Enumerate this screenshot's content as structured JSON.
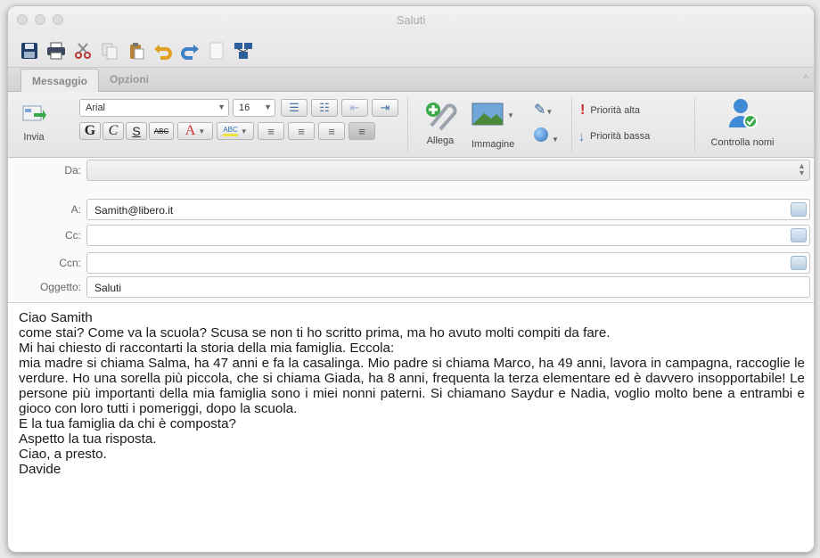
{
  "window": {
    "title": "Saluti"
  },
  "toolbar": {
    "buttons": [
      "save-icon",
      "print-icon",
      "cut-icon",
      "copy-icon",
      "paste-icon",
      "undo-icon",
      "redo-icon",
      "document-icon",
      "network-icon"
    ]
  },
  "tabs": [
    {
      "label": "Messaggio",
      "active": true
    },
    {
      "label": "Opzioni",
      "active": false
    }
  ],
  "ribbon": {
    "send_label": "Invia",
    "font_name": "Arial",
    "font_size": "16",
    "bold": "G",
    "italic": "C",
    "underline": "S",
    "strike": "ABC",
    "font_color": "A",
    "highlight": "ABC",
    "attach_label": "Allega",
    "image_label": "Immagine",
    "priority_high": "Priorità alta",
    "priority_low": "Priorità bassa",
    "check_names": "Controlla nomi"
  },
  "header": {
    "from": {
      "label": "Da:",
      "value": ""
    },
    "to": {
      "label": "A:",
      "value": "Samith@libero.it"
    },
    "cc": {
      "label": "Cc:",
      "value": ""
    },
    "bcc": {
      "label": "Ccn:",
      "value": ""
    },
    "subject": {
      "label": "Oggetto:",
      "value": "Saluti"
    }
  },
  "message": {
    "line1": "Ciao Samith",
    "line2": "come stai? Come va la scuola? Scusa se non ti ho scritto prima, ma ho avuto molti compiti da fare.",
    "line3": "Mi hai chiesto di raccontarti la storia della mia famiglia. Eccola:",
    "paragraph": "mia madre si chiama Salma, ha 47 anni e fa la casalinga. Mio padre si chiama Marco, ha 49 anni, lavora in campagna, raccoglie le verdure. Ho una sorella più piccola, che  si chiama Giada, ha 8 anni, frequenta la terza elementare ed è davvero insopportabile! Le persone più importanti della mia famiglia sono i miei nonni paterni. Si chiamano Saydur e Nadia, voglio molto bene a entrambi e gioco con loro tutti i pomeriggi, dopo la scuola.",
    "line5": "E la tua famiglia da chi è composta?",
    "line6": "Aspetto la tua risposta.",
    "line7": "Ciao, a presto.",
    "line8": "Davide"
  },
  "colors": {
    "accent_red": "#cc2a2a",
    "accent_blue": "#2b6fb5",
    "accent_green": "#3aa94a"
  }
}
